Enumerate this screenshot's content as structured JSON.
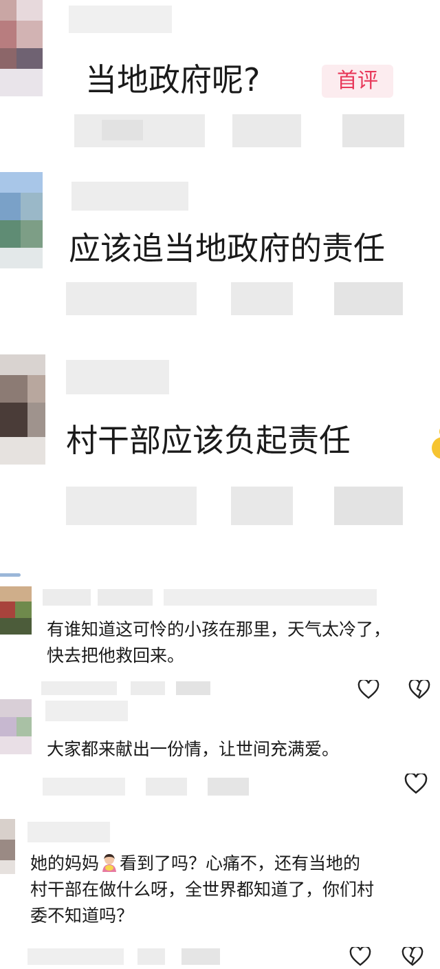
{
  "comments": [
    {
      "text": "当地政府呢?",
      "badge": "首评"
    },
    {
      "text": "应该追当地政府的责任"
    },
    {
      "text": "村干部应该负起责任"
    },
    {
      "lines": [
        "有谁知道这可怜的小孩在那里，天气太冷了，",
        "快去把他救回来。"
      ]
    },
    {
      "lines": [
        "大家都来献出一份情，让世间充满爱。"
      ]
    },
    {
      "lines_a": "她的妈妈",
      "lines_b": "看到了吗？心痛不，还有当地的",
      "lines": [
        "村干部在做什么呀，全世界都知道了，你们村",
        "委不知道吗？"
      ]
    }
  ],
  "icons": {
    "like": "heart-outline-icon",
    "dislike": "broken-heart-icon",
    "emoji_mother": "mother-emoji-icon",
    "emoji_partial": "emoji-icon"
  },
  "colors": {
    "badge_bg": "#fcecef",
    "badge_text": "#e8385a",
    "pixelated_gray": "#dcdcdc"
  }
}
